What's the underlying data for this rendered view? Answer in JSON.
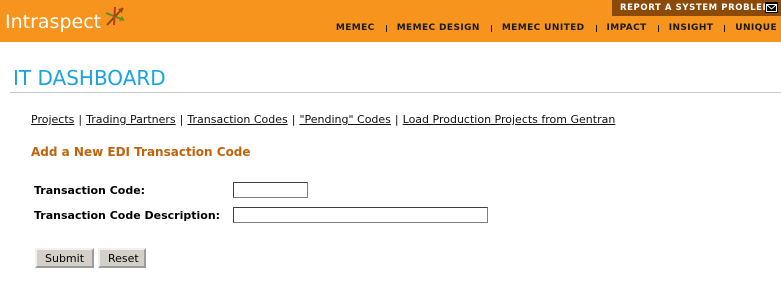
{
  "header": {
    "logo_text": "Intraspect",
    "report_link": "REPORT A SYSTEM PROBLEM",
    "nav": [
      "MEMEC",
      "MEMEC DESIGN",
      "MEMEC UNITED",
      "IMPACT",
      "INSIGHT",
      "UNIQUE"
    ]
  },
  "page": {
    "title": "IT DASHBOARD"
  },
  "links": {
    "projects": "Projects",
    "trading_partners": "Trading Partners",
    "transaction_codes": "Transaction Codes",
    "pending_codes": "\"Pending\" Codes",
    "load_production": "Load Production Projects from Gentran",
    "separator": "|"
  },
  "form": {
    "heading": "Add a New EDI Transaction Code",
    "code_label": "Transaction Code:",
    "code_value": "",
    "description_label": "Transaction Code Description:",
    "description_value": "",
    "submit_label": "Submit",
    "reset_label": "Reset"
  },
  "colors": {
    "header_bg": "#f7941d",
    "report_bg": "#8c4a08",
    "title": "#1aa3e0",
    "heading": "#c0630c"
  },
  "icons": {
    "logo_mark": "compass-arrows-icon",
    "mail": "envelope-icon"
  }
}
